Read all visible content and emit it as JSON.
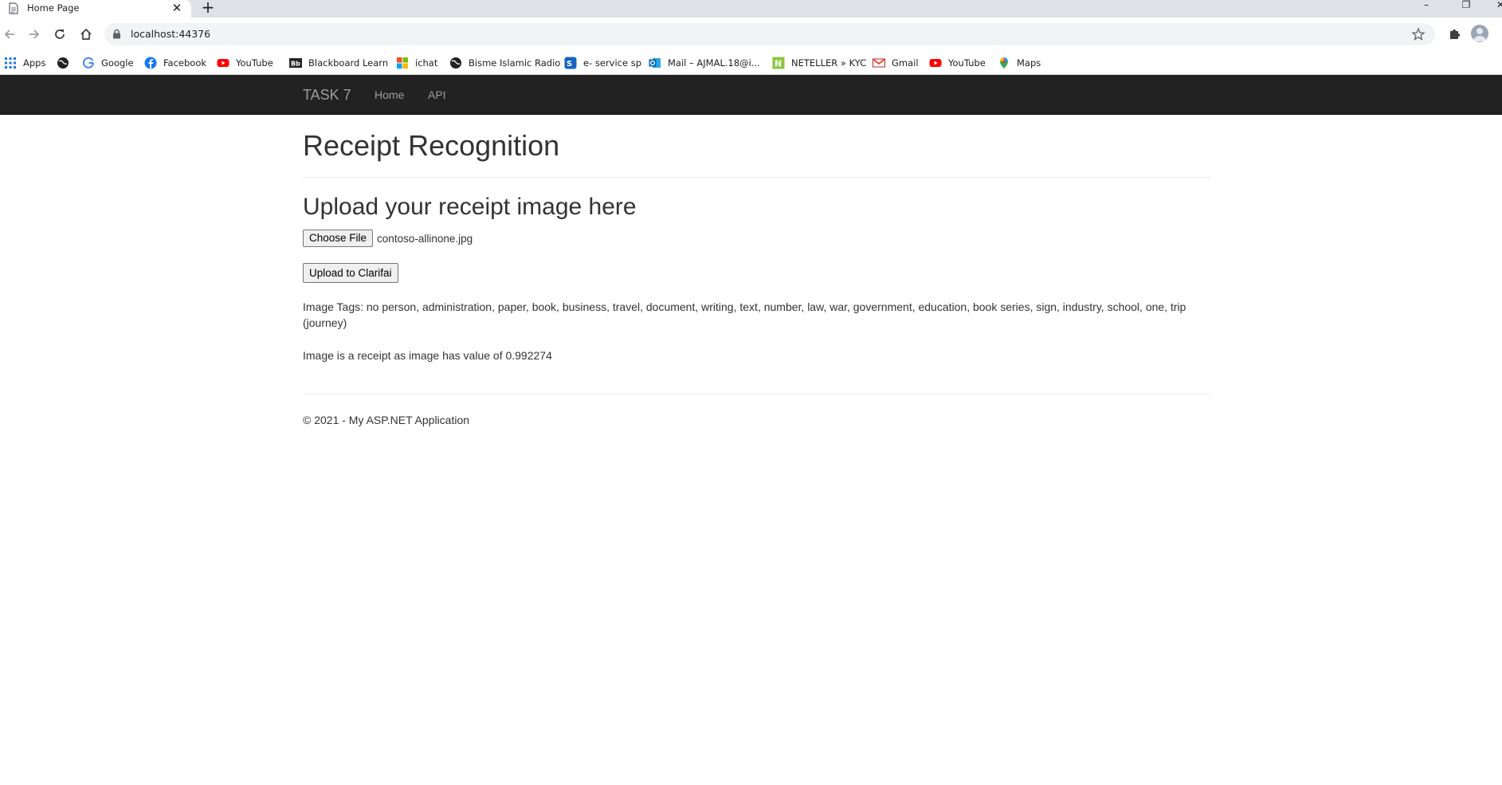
{
  "browser": {
    "tab_title": "Home Page",
    "tab_close": "✕",
    "new_tab": "+",
    "url": "localhost:44376",
    "window_controls": [
      "–",
      "❐",
      "✕"
    ],
    "bookmarks": [
      {
        "label": "Apps",
        "icon": "apps-grid-icon"
      },
      {
        "label": "",
        "icon": "globe-icon"
      },
      {
        "label": "Google",
        "icon": "google-icon"
      },
      {
        "label": "Facebook",
        "icon": "facebook-icon"
      },
      {
        "label": "YouTube",
        "icon": "youtube-icon"
      },
      {
        "label": "Blackboard Learn",
        "icon": "blackboard-icon"
      },
      {
        "label": "ichat",
        "icon": "ichat-icon"
      },
      {
        "label": "Bisme Islamic Radio",
        "icon": "globe-icon"
      },
      {
        "label": "e- service sp",
        "icon": "eservice-icon"
      },
      {
        "label": "Mail – AJMAL.18@i...",
        "icon": "outlook-icon"
      },
      {
        "label": "NETELLER » KYC",
        "icon": "neteller-icon"
      },
      {
        "label": "Gmail",
        "icon": "gmail-icon"
      },
      {
        "label": "YouTube",
        "icon": "youtube-icon"
      },
      {
        "label": "Maps",
        "icon": "maps-icon"
      }
    ]
  },
  "navbar": {
    "brand": "TASK 7",
    "links": [
      "Home",
      "API"
    ]
  },
  "main": {
    "title": "Receipt Recognition",
    "upload_heading": "Upload your receipt image here",
    "choose_file_label": "Choose File",
    "file_name": "contoso-allinone.jpg",
    "upload_button": "Upload to Clarifai",
    "tags_text": "Image Tags: no person, administration, paper, book, business, travel, document, writing, text, number, law, war, government, education, book series, sign, industry, school, one, trip (journey)",
    "result_text": "Image is a receipt as image has value of 0.992274"
  },
  "footer": {
    "text": "© 2021 - My ASP.NET Application"
  },
  "colors": {
    "navbar_bg": "#222222",
    "navbar_text": "#9d9d9d",
    "chrome_tabstrip": "#dee1e6",
    "omnibox_bg": "#f1f3f4"
  }
}
